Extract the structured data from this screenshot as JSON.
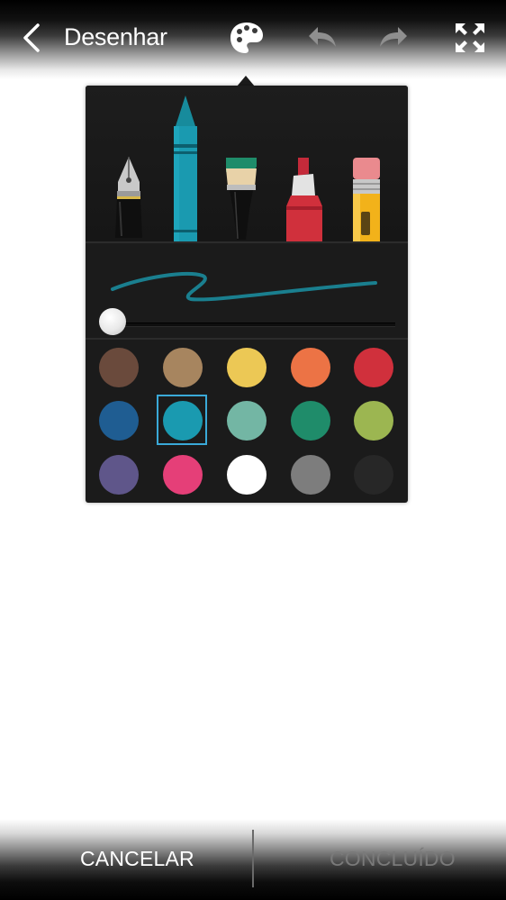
{
  "header": {
    "title": "Desenhar",
    "icons": [
      "back-arrow-icon",
      "palette-icon",
      "undo-icon",
      "redo-icon",
      "fullscreen-icon"
    ]
  },
  "tools": [
    "fountain-pen-icon",
    "crayon-icon",
    "paintbrush-icon",
    "marker-icon",
    "eraser-icon"
  ],
  "brush": {
    "color": "#1a9ab0",
    "size_level": 0.0
  },
  "palette": {
    "colors": [
      "#6a4a3c",
      "#a7855f",
      "#ecc855",
      "#ec7345",
      "#d0303c",
      "#1f5d92",
      "#1a9ab0",
      "#73b6a4",
      "#1f8c6a",
      "#9cb651",
      "#5f568a",
      "#e53f78",
      "#ffffff",
      "#7d7d7d",
      "#272727"
    ],
    "selected_index": 6
  },
  "footer": {
    "cancel_label": "CANCELAR",
    "done_label": "CONCLUÍDO"
  }
}
